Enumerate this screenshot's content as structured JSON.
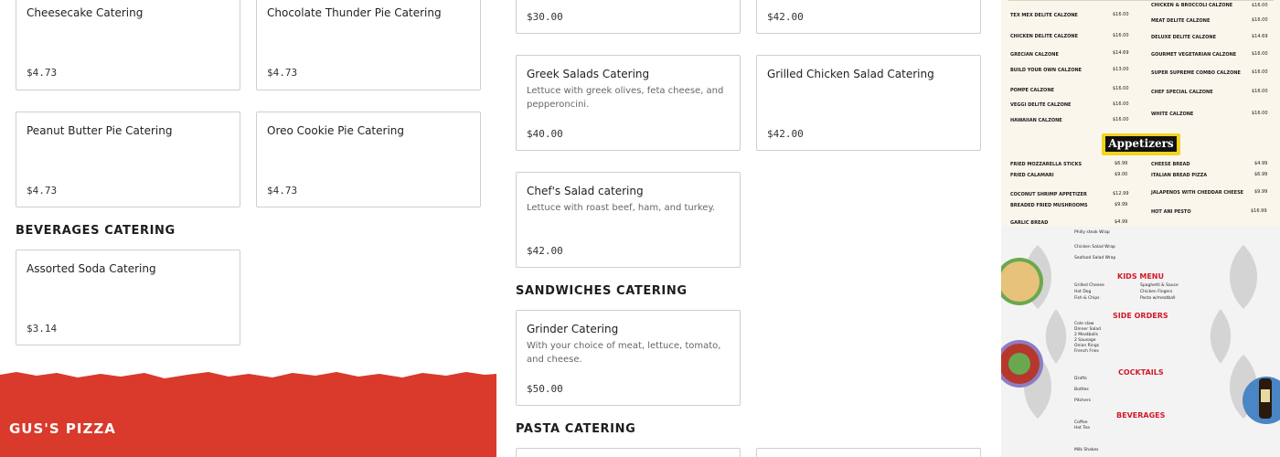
{
  "col1": {
    "top_cards": [
      {
        "name": "Cheesecake Catering",
        "price": "$4.73"
      },
      {
        "name": "Chocolate Thunder Pie Catering",
        "price": "$4.73"
      },
      {
        "name": "Peanut Butter Pie Catering",
        "price": "$4.73"
      },
      {
        "name": "Oreo Cookie Pie Catering",
        "price": "$4.73"
      }
    ],
    "beverages_heading": "BEVERAGES CATERING",
    "beverages": [
      {
        "name": "Assorted Soda Catering",
        "price": "$3.14"
      }
    ]
  },
  "col2": {
    "partial_top": [
      {
        "price": "$30.00"
      },
      {
        "price": "$42.00"
      }
    ],
    "salads": [
      {
        "name": "Greek Salads Catering",
        "desc": "Lettuce with greek olives, feta cheese, and pepperoncini.",
        "price": "$40.00"
      },
      {
        "name": "Grilled Chicken Salad Catering",
        "price": "$42.00"
      },
      {
        "name": "Chef's Salad catering",
        "desc": "Lettuce with roast beef, ham, and turkey.",
        "price": "$42.00"
      }
    ],
    "sandwiches_heading": "SANDWICHES CATERING",
    "sandwiches": [
      {
        "name": "Grinder Catering",
        "desc": "With your choice of meat, lettuce, tomato, and cheese.",
        "price": "$50.00"
      }
    ],
    "pasta_heading": "PASTA CATERING"
  },
  "footer": {
    "brand": "GUS'S PIZZA",
    "accent": "#d93a2b"
  },
  "menu_image": {
    "calzones_left": [
      {
        "name": "TEX MEX DELITE CALZONE",
        "price": "$16.00"
      },
      {
        "name": "CHICKEN DELITE CALZONE",
        "price": "$16.00"
      },
      {
        "name": "GRECIAN CALZONE",
        "price": "$14.69"
      },
      {
        "name": "BUILD YOUR OWN CALZONE",
        "price": "$13.00"
      },
      {
        "name": "POMPE CALZONE",
        "price": "$16.00"
      },
      {
        "name": "VEGGI DELITE CALZONE",
        "price": "$16.00"
      },
      {
        "name": "HAWAIIAN CALZONE",
        "price": "$16.00"
      }
    ],
    "calzones_right": [
      {
        "name": "CHICKEN & BROCCOLI CALZONE",
        "price": "$16.00"
      },
      {
        "name": "MEAT DELITE CALZONE",
        "price": "$16.00"
      },
      {
        "name": "DELUXE DELITE CALZONE",
        "price": "$14.69"
      },
      {
        "name": "GOURMET VEGETARIAN CALZONE",
        "price": "$16.00"
      },
      {
        "name": "SUPER SUPREME COMBO CALZONE",
        "price": "$16.00"
      },
      {
        "name": "CHEF SPECIAL CALZONE",
        "price": "$16.00"
      },
      {
        "name": "WHITE CALZONE",
        "price": "$16.00"
      }
    ],
    "appetizers_title": "Appetizers",
    "appetizers_left": [
      {
        "name": "FRIED MOZZARELLA STICKS",
        "price": "$6.99"
      },
      {
        "name": "FRIED CALAMARI",
        "price": "$9.00"
      },
      {
        "name": "COCONUT SHRIMP APPETIZER",
        "price": "$12.99"
      },
      {
        "name": "BREADED FRIED MUSHROOMS",
        "price": "$9.99"
      },
      {
        "name": "GARLIC BREAD",
        "price": "$4.99"
      }
    ],
    "appetizers_right": [
      {
        "name": "CHEESE BREAD",
        "price": "$4.99"
      },
      {
        "name": "ITALIAN BREAD PIZZA",
        "price": "$6.99"
      },
      {
        "name": "JALAPENOS WITH CHEDDAR CHEESE",
        "price": "$9.99"
      },
      {
        "name": "HOT ANI PESTO",
        "price": "$16.99"
      }
    ],
    "kids_title": "KIDS MENU",
    "side_title": "SIDE ORDERS",
    "cocktails_title": "COCKTAILS",
    "beverages_title": "BEVERAGES",
    "wraps": [
      "Philly steak Wrap",
      "Chicken Salad Wrap",
      "Seafood Salad Wrap"
    ],
    "kids_left": [
      "Grilled Cheese",
      "Hot Dog",
      "Fish & Chips"
    ],
    "kids_right": [
      "Spaghetti & Sauce",
      "Chicken Fingers",
      "Pasta w/meatball"
    ],
    "sides": [
      "Cole slaw",
      "Dinner Salad",
      "2 Meatballs",
      "2 Sausage",
      "Onion Rings",
      "French Fries"
    ],
    "cocktails": [
      "Drafts",
      "Bottles",
      "Pitchers"
    ],
    "beverages": [
      "Coffee",
      "Hot Tea",
      "Milk Shakes"
    ],
    "colors": {
      "red": "#d11a2a",
      "yellow": "#f3d31c",
      "cream": "#fbf6ec"
    }
  }
}
